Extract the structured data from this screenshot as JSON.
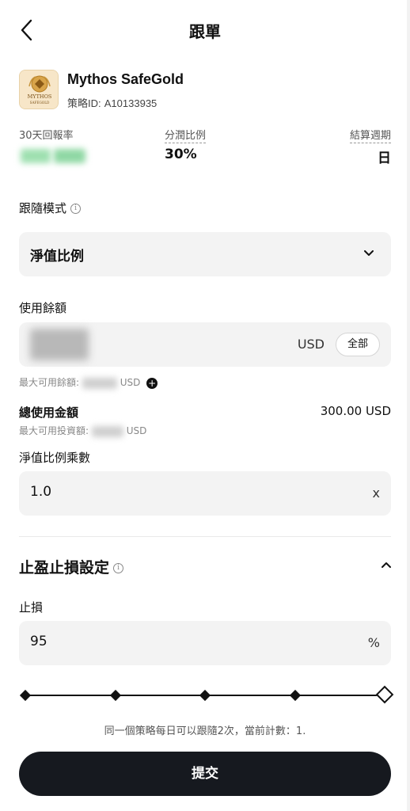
{
  "header": {
    "title": "跟單"
  },
  "strategy": {
    "name": "Mythos SafeGold",
    "id_label": "策略ID:",
    "id_value": "A10133935",
    "logo_text_top": "MYTHOS",
    "logo_text_bottom": "SAFEGOLD"
  },
  "stats": {
    "return_label": "30天回報率",
    "share_label": "分潤比例",
    "share_value": "30%",
    "period_label": "結算週期",
    "period_value": "日"
  },
  "follow_mode": {
    "label": "跟隨模式",
    "info": "i",
    "selected": "淨值比例"
  },
  "balance": {
    "label": "使用餘額",
    "unit": "USD",
    "all_button": "全部",
    "max_hint_label": "最大可用餘額:",
    "max_hint_unit": "USD"
  },
  "total": {
    "label": "總使用金額",
    "value": "300.00 USD",
    "max_invest_label": "最大可用投資額:",
    "max_invest_unit": "USD"
  },
  "multiplier": {
    "label": "淨值比例乘數",
    "value": "1.0",
    "unit": "x"
  },
  "tp_sl": {
    "title": "止盈止損設定",
    "info": "i",
    "stop_loss_label": "止損",
    "stop_loss_value": "95",
    "stop_loss_unit": "%"
  },
  "slider": {
    "level": 1.0,
    "stops": 5
  },
  "notice": "同一個策略每日可以跟隨2次，當前計數：1.",
  "submit_label": "提交",
  "colors": {
    "primary": "#16191f",
    "field_bg": "#f3f3f3",
    "blurred_return": "#7fd49a"
  }
}
